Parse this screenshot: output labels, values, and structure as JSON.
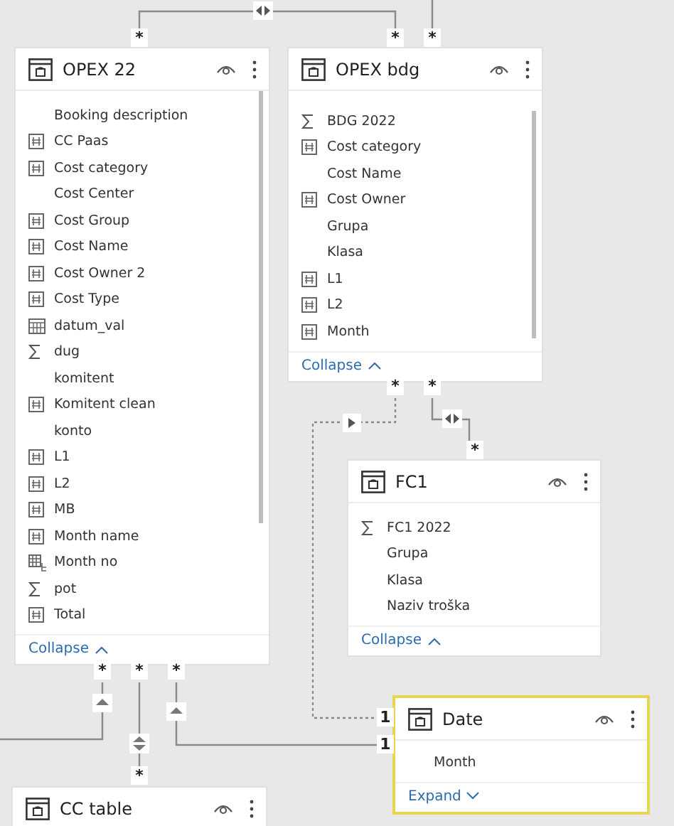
{
  "tables": [
    {
      "name": "OPEX 22",
      "selected": false,
      "expanded": true,
      "footer": "Collapse",
      "fields": [
        {
          "name": "Booking description",
          "kind": "text"
        },
        {
          "name": "CC Paas",
          "kind": "column"
        },
        {
          "name": "Cost category",
          "kind": "column"
        },
        {
          "name": "Cost Center",
          "kind": "text"
        },
        {
          "name": "Cost Group",
          "kind": "column"
        },
        {
          "name": "Cost Name",
          "kind": "column"
        },
        {
          "name": "Cost Owner 2",
          "kind": "column"
        },
        {
          "name": "Cost Type",
          "kind": "column"
        },
        {
          "name": "datum_val",
          "kind": "date"
        },
        {
          "name": "dug",
          "kind": "sum"
        },
        {
          "name": "komitent",
          "kind": "text"
        },
        {
          "name": "Komitent clean",
          "kind": "column"
        },
        {
          "name": "konto",
          "kind": "text"
        },
        {
          "name": "L1",
          "kind": "column"
        },
        {
          "name": "L2",
          "kind": "column"
        },
        {
          "name": "MB",
          "kind": "column"
        },
        {
          "name": "Month name",
          "kind": "column"
        },
        {
          "name": "Month no",
          "kind": "hierarchy"
        },
        {
          "name": "pot",
          "kind": "sum"
        },
        {
          "name": "Total",
          "kind": "column"
        }
      ]
    },
    {
      "name": "OPEX bdg",
      "selected": false,
      "expanded": true,
      "footer": "Collapse",
      "fields": [
        {
          "name": "BDG 2022",
          "kind": "sum"
        },
        {
          "name": "Cost category",
          "kind": "column"
        },
        {
          "name": "Cost Name",
          "kind": "text"
        },
        {
          "name": "Cost Owner",
          "kind": "column"
        },
        {
          "name": "Grupa",
          "kind": "text"
        },
        {
          "name": "Klasa",
          "kind": "text"
        },
        {
          "name": "L1",
          "kind": "column"
        },
        {
          "name": "L2",
          "kind": "column"
        },
        {
          "name": "Month",
          "kind": "column"
        }
      ]
    },
    {
      "name": "FC1",
      "selected": false,
      "expanded": true,
      "footer": "Collapse",
      "fields": [
        {
          "name": "FC1 2022",
          "kind": "sum"
        },
        {
          "name": "Grupa",
          "kind": "text"
        },
        {
          "name": "Klasa",
          "kind": "text"
        },
        {
          "name": "Naziv troška",
          "kind": "text"
        }
      ]
    },
    {
      "name": "Date",
      "selected": true,
      "expanded": false,
      "footer": "Expand",
      "fields": [
        {
          "name": "Month",
          "kind": "text"
        }
      ]
    },
    {
      "name": "CC table",
      "selected": false
    }
  ],
  "cardinality_labels": [
    "*",
    "*",
    "*",
    "*",
    "*",
    "*",
    "*",
    "*",
    "*",
    "*",
    "1",
    "1"
  ]
}
